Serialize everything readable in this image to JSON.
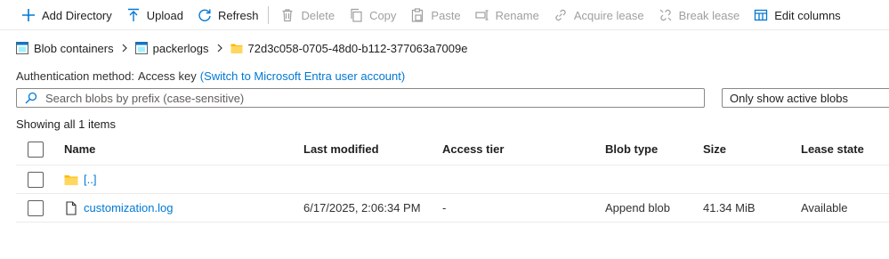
{
  "toolbar": {
    "add_directory": "Add Directory",
    "upload": "Upload",
    "refresh": "Refresh",
    "delete": "Delete",
    "copy": "Copy",
    "paste": "Paste",
    "rename": "Rename",
    "acquire_lease": "Acquire lease",
    "break_lease": "Break lease",
    "edit_columns": "Edit columns"
  },
  "breadcrumb": {
    "items": [
      "Blob containers",
      "packerlogs",
      "72d3c058-0705-48d0-b112-377063a7009e"
    ]
  },
  "auth": {
    "label": "Authentication method:",
    "value": "Access key",
    "switch_link": "(Switch to Microsoft Entra user account)"
  },
  "search": {
    "placeholder": "Search blobs by prefix (case-sensitive)",
    "value": ""
  },
  "filter": {
    "selected": "Only show active blobs"
  },
  "status": {
    "count_text": "Showing all 1 items"
  },
  "table": {
    "columns": [
      "Name",
      "Last modified",
      "Access tier",
      "Blob type",
      "Size",
      "Lease state"
    ],
    "rows": [
      {
        "name": "[..]",
        "modified": "",
        "tier": "",
        "type": "",
        "size": "",
        "lease": ""
      },
      {
        "name": "customization.log",
        "modified": "6/17/2025, 2:06:34 PM",
        "tier": "-",
        "type": "Append blob",
        "size": "41.34 MiB",
        "lease": "Available"
      }
    ]
  },
  "colors": {
    "accent": "#0078d4",
    "folder": "#ffb900",
    "disabled": "#a19f9d"
  },
  "icons": {
    "add_directory": "plus-icon",
    "upload": "upload-arrow-icon",
    "refresh": "refresh-icon",
    "delete": "trash-icon",
    "copy": "copy-icon",
    "paste": "paste-icon",
    "rename": "rename-icon",
    "acquire_lease": "link-icon",
    "break_lease": "broken-link-icon",
    "edit_columns": "columns-icon",
    "container": "container-icon",
    "folder": "folder-icon",
    "file": "file-icon",
    "search": "search-icon"
  }
}
